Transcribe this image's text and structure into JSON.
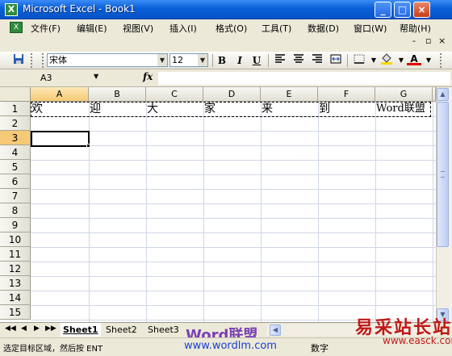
{
  "window": {
    "title": "Microsoft Excel - Book1",
    "app_icon": "excel-icon",
    "buttons": [
      "minimize",
      "maximize",
      "close"
    ]
  },
  "menu": {
    "items": [
      "文件(F)",
      "编辑(E)",
      "视图(V)",
      "插入(I)",
      "格式(O)",
      "工具(T)",
      "数据(D)",
      "窗口(W)",
      "帮助(H)"
    ],
    "help_hint_close": "× ",
    "doc_controls": [
      "-",
      "▫",
      "×"
    ]
  },
  "toolbar": {
    "font": "宋体",
    "size": "12",
    "bold": "B",
    "italic": "I",
    "underline": "U"
  },
  "formula_bar": {
    "name_box": "A3",
    "fx": "fx",
    "formula": ""
  },
  "grid": {
    "columns": [
      "A",
      "B",
      "C",
      "D",
      "E",
      "F",
      "G"
    ],
    "selected_column": "A",
    "rows": [
      "1",
      "2",
      "3",
      "4",
      "5",
      "6",
      "7",
      "8",
      "9",
      "10",
      "11",
      "12",
      "13",
      "14",
      "15"
    ],
    "selected_row": "3",
    "row1_cells": [
      "欢",
      "迎",
      "大",
      "家",
      "来",
      "到",
      "Word联盟"
    ],
    "active_cell": "A3"
  },
  "sheets": {
    "tabs": [
      "Sheet1",
      "Sheet2",
      "Sheet3"
    ],
    "active": "Sheet1",
    "nav": [
      "◀◀",
      "◀",
      "▶",
      "▶▶"
    ]
  },
  "status": {
    "message": "选定目标区域，然后按 ENTER 或选择“粘贴”",
    "message_visible": "选定目标区域，然后按 ENT",
    "mode": "数字"
  },
  "watermarks": {
    "word_logo": "Word联盟",
    "word_url": "www.wordlm.com",
    "site_cn": "易采站长站",
    "site_en": "www.easck.com"
  }
}
